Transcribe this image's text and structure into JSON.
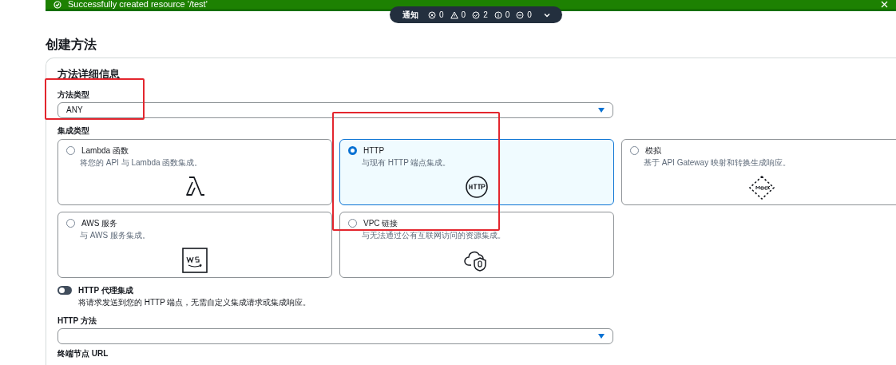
{
  "flash": {
    "message": "Successfully created resource '/test'"
  },
  "notifications": {
    "label": "通知",
    "counts": [
      {
        "kind": "error",
        "count": "0"
      },
      {
        "kind": "warning",
        "count": "0"
      },
      {
        "kind": "success",
        "count": "2"
      },
      {
        "kind": "info",
        "count": "0"
      },
      {
        "kind": "blocked",
        "count": "0"
      }
    ]
  },
  "page_title": "创建方法",
  "details": {
    "title": "方法详细信息",
    "method_type": {
      "label": "方法类型",
      "value": "ANY",
      "highlighted": true
    },
    "integration_type": {
      "label": "集成类型",
      "options": [
        {
          "kind": "lambda",
          "title": "Lambda 函数",
          "description": "将您的 API 与 Lambda 函数集成。",
          "selected": false,
          "highlighted": false
        },
        {
          "kind": "http",
          "title": "HTTP",
          "description": "与现有 HTTP 端点集成。",
          "selected": true,
          "highlighted": true
        },
        {
          "kind": "mock",
          "title": "模拟",
          "description": "基于 API Gateway 映射和转换生成响应。",
          "selected": false,
          "highlighted": false
        },
        {
          "kind": "aws",
          "title": "AWS 服务",
          "description": "与 AWS 服务集成。",
          "selected": false,
          "highlighted": false
        },
        {
          "kind": "vpc",
          "title": "VPC 链接",
          "description": "与无法通过公有互联网访问的资源集成。",
          "selected": false,
          "highlighted": false
        }
      ]
    },
    "proxy": {
      "label": "HTTP 代理集成",
      "description": "将请求发送到您的 HTTP 端点，无需自定义集成请求或集成响应。",
      "on": false
    },
    "http_method": {
      "label": "HTTP 方法"
    },
    "endpoint_url": {
      "label": "终端节点 URL"
    }
  }
}
